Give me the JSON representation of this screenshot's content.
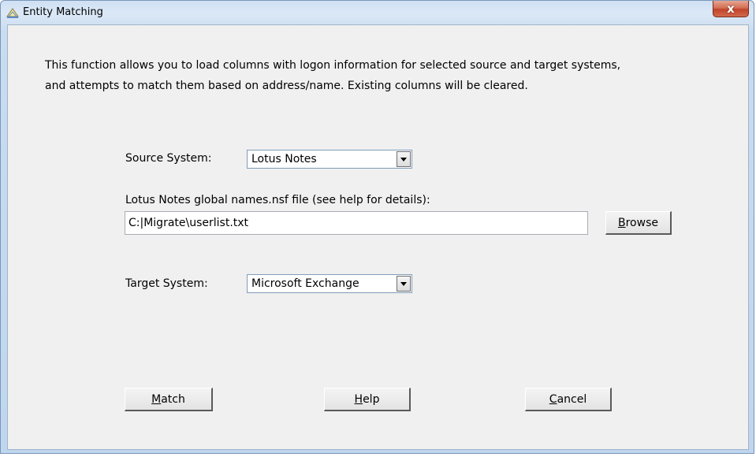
{
  "window": {
    "title": "Entity Matching",
    "close_glyph": "x",
    "icon": "entity-matching-icon"
  },
  "description": {
    "line1": "This function allows you to load columns with logon information for selected source and target systems,",
    "line2": "and attempts to match them based on address/name.  Existing columns will be cleared."
  },
  "source": {
    "label": "Source System:",
    "selected": "Lotus Notes"
  },
  "names_file": {
    "label": "Lotus Notes global names.nsf file (see help for details):",
    "value": "C:|Migrate\\userlist.txt",
    "browse_mnemonic": "B",
    "browse_rest": "rowse"
  },
  "target": {
    "label": "Target System:",
    "selected": "Microsoft Exchange"
  },
  "buttons": {
    "match_mnemonic": "M",
    "match_rest": "atch",
    "help_mnemonic": "H",
    "help_rest": "elp",
    "cancel_mnemonic": "C",
    "cancel_rest": "ancel"
  }
}
